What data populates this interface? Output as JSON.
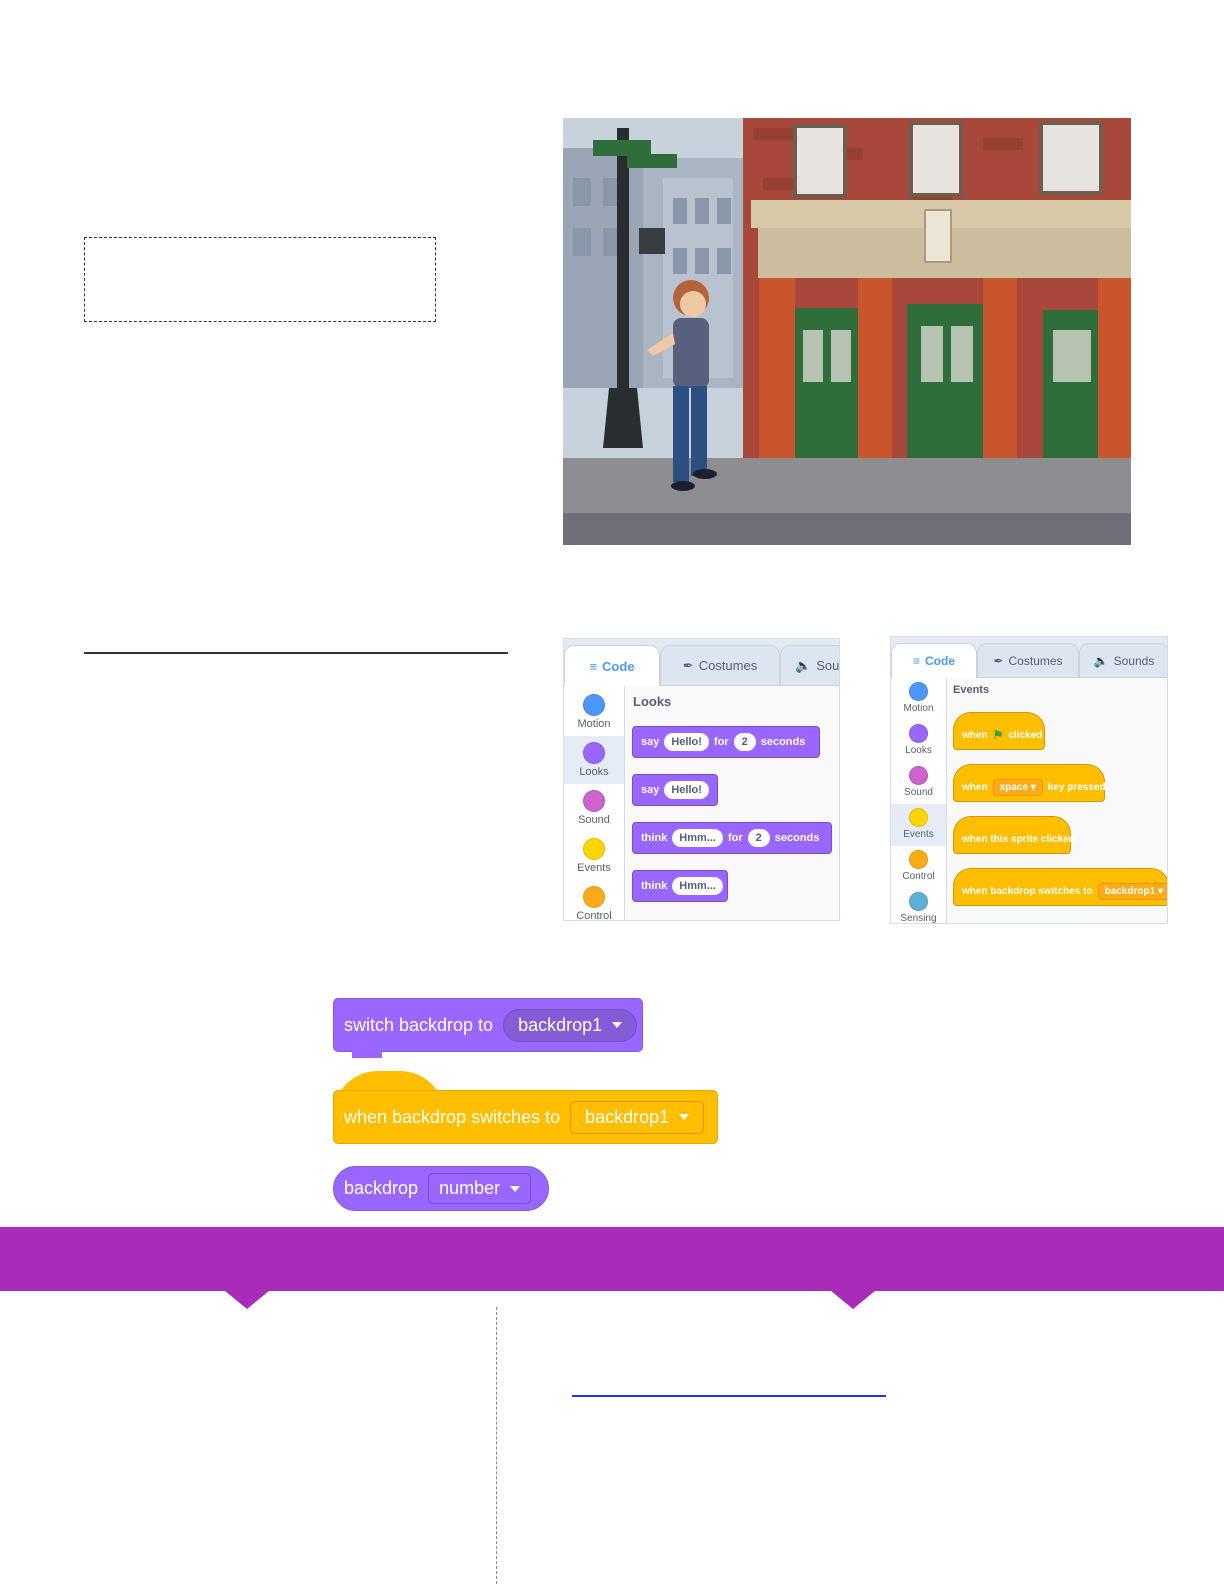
{
  "stage": {
    "scene": "street-corner-with-red-brick-building",
    "sprite": "boy-character"
  },
  "panel_looks": {
    "tabs": [
      {
        "label": "Code",
        "icon": "code-icon"
      },
      {
        "label": "Costumes",
        "icon": "brush-icon"
      },
      {
        "label": "Sou",
        "icon": "speaker-icon"
      }
    ],
    "categories": [
      {
        "label": "Motion",
        "color": "#4c97ff"
      },
      {
        "label": "Looks",
        "color": "#9966ff"
      },
      {
        "label": "Sound",
        "color": "#cf63cf"
      },
      {
        "label": "Events",
        "color": "#ffd500"
      },
      {
        "label": "Control",
        "color": "#ffab19"
      }
    ],
    "palette_title": "Looks",
    "blocks": [
      {
        "verb": "say",
        "arg": "Hello!",
        "mid": "for",
        "num": "2",
        "end": "seconds"
      },
      {
        "verb": "say",
        "arg": "Hello!"
      },
      {
        "verb": "think",
        "arg": "Hmm...",
        "mid": "for",
        "num": "2",
        "end": "seconds"
      },
      {
        "verb": "think",
        "arg": "Hmm..."
      }
    ]
  },
  "panel_events": {
    "tabs": [
      {
        "label": "Code",
        "icon": "code-icon"
      },
      {
        "label": "Costumes",
        "icon": "brush-icon"
      },
      {
        "label": "Sounds",
        "icon": "speaker-icon"
      }
    ],
    "categories": [
      {
        "label": "Motion",
        "color": "#4c97ff"
      },
      {
        "label": "Looks",
        "color": "#9966ff"
      },
      {
        "label": "Sound",
        "color": "#cf63cf"
      },
      {
        "label": "Events",
        "color": "#ffd500"
      },
      {
        "label": "Control",
        "color": "#ffab19"
      },
      {
        "label": "Sensing",
        "color": "#5cb1d6"
      }
    ],
    "palette_title": "Events",
    "blocks": [
      {
        "pre": "when",
        "post": "clicked"
      },
      {
        "pre": "when",
        "dropdown": "space",
        "post": "key pressed"
      },
      {
        "pre": "when this sprite clicked"
      },
      {
        "pre": "when backdrop switches to",
        "dropdown": "backdrop1"
      }
    ]
  },
  "big_blocks": {
    "switch": {
      "label": "switch backdrop to",
      "dropdown": "backdrop1"
    },
    "when": {
      "label": "when backdrop switches to",
      "dropdown": "backdrop1"
    },
    "reporter": {
      "label": "backdrop",
      "dropdown": "number"
    }
  },
  "colors": {
    "looks": "#9966ff",
    "events": "#ffbf00",
    "band": "#a92cb8",
    "link_line": "#2233ee"
  }
}
